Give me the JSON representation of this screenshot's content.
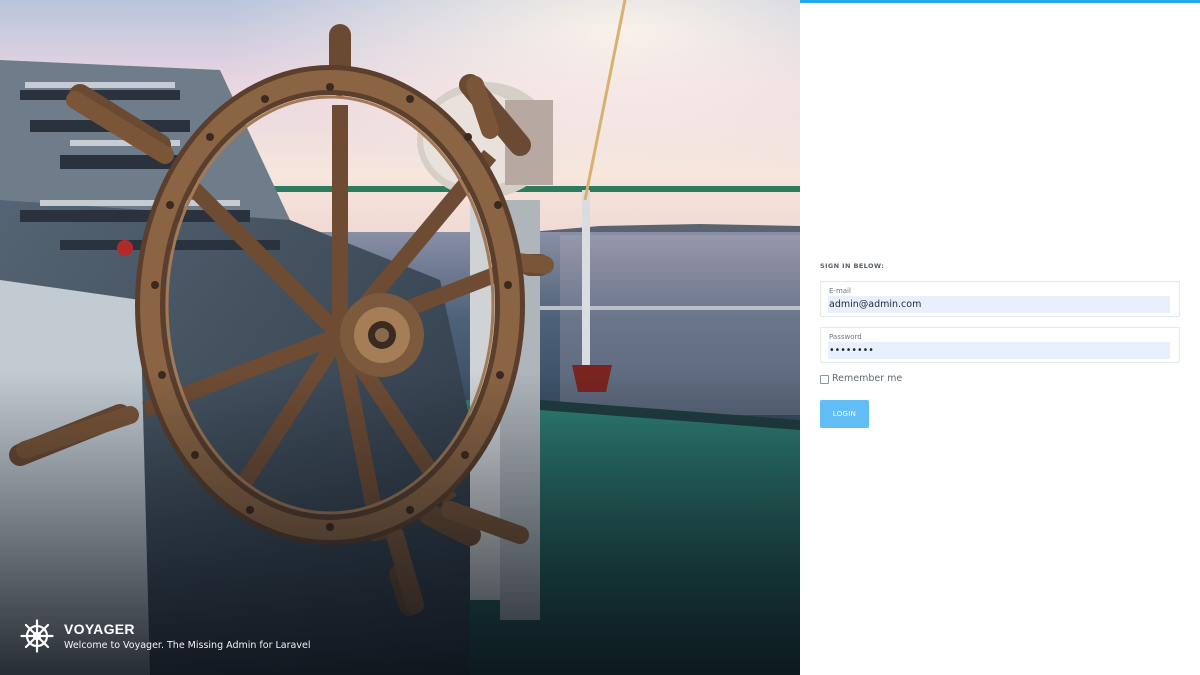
{
  "brand": {
    "title": "VOYAGER",
    "tagline": "Welcome to Voyager. The Missing Admin for Laravel",
    "logo_icon": "ship-wheel-icon"
  },
  "login": {
    "heading": "SIGN IN BELOW:",
    "email_label": "E-mail",
    "email_value": "admin@admin.com",
    "password_label": "Password",
    "password_value": "password",
    "remember_label": "Remember me",
    "remember_checked": false,
    "submit_label": "LOGIN"
  },
  "colors": {
    "accent": "#22a7f0",
    "button": "#62bdf6",
    "autofill": "#e8f0fe"
  }
}
